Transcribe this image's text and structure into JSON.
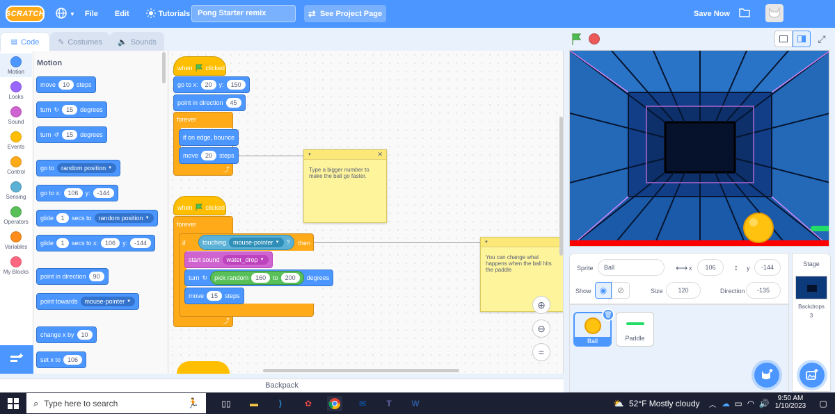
{
  "menubar": {
    "logo": "SCRATCH",
    "file": "File",
    "edit": "Edit",
    "tutorials": "Tutorials",
    "project_title": "Pong Starter remix",
    "see_project": "See Project Page",
    "save_now": "Save Now"
  },
  "tabs": {
    "code": "Code",
    "costumes": "Costumes",
    "sounds": "Sounds"
  },
  "categories": [
    {
      "label": "Motion",
      "color": "#4c97ff"
    },
    {
      "label": "Looks",
      "color": "#9966ff"
    },
    {
      "label": "Sound",
      "color": "#cf63cf"
    },
    {
      "label": "Events",
      "color": "#ffbf00"
    },
    {
      "label": "Control",
      "color": "#ffab19"
    },
    {
      "label": "Sensing",
      "color": "#5cb1d6"
    },
    {
      "label": "Operators",
      "color": "#59c059"
    },
    {
      "label": "Variables",
      "color": "#ff8c1a"
    },
    {
      "label": "My Blocks",
      "color": "#ff6680"
    }
  ],
  "palette": {
    "heading": "Motion",
    "move": {
      "a": "move",
      "v": "10",
      "b": "steps"
    },
    "turn_right": {
      "a": "turn",
      "v": "15",
      "b": "degrees"
    },
    "turn_left": {
      "a": "turn",
      "v": "15",
      "b": "degrees"
    },
    "goto": {
      "a": "go to",
      "dd": "random position"
    },
    "goto_xy": {
      "a": "go to x:",
      "x": "106",
      "b": "y:",
      "y": "-144"
    },
    "glide": {
      "a": "glide",
      "v": "1",
      "b": "secs to",
      "dd": "random position"
    },
    "glide_xy": {
      "a": "glide",
      "v": "1",
      "b": "secs to x:",
      "x": "106",
      "c": "y:",
      "y": "-144"
    },
    "point_dir": {
      "a": "point in direction",
      "v": "90"
    },
    "point_towards": {
      "a": "point towards",
      "dd": "mouse-pointer"
    },
    "change_x": {
      "a": "change x by",
      "v": "10"
    },
    "set_x": {
      "a": "set x to",
      "v": "106"
    }
  },
  "script1": {
    "when": "when",
    "clicked": "clicked",
    "goto_a": "go to x:",
    "goto_x": "20",
    "goto_b": "y:",
    "goto_y": "150",
    "point_a": "point in direction",
    "point_v": "45",
    "forever": "forever",
    "bounce": "if on edge, bounce",
    "move_a": "move",
    "move_v": "20",
    "move_b": "steps"
  },
  "script2": {
    "when": "when",
    "clicked": "clicked",
    "forever": "forever",
    "if": "if",
    "touching": "touching",
    "touching_dd": "mouse-pointer",
    "q": "?",
    "then": "then",
    "sound_a": "start sound",
    "sound_dd": "water_drop",
    "turn_a": "turn",
    "pick": "pick random",
    "pick_a": "160",
    "pick_to": "to",
    "pick_b": "200",
    "turn_b": "degrees",
    "move_a": "move",
    "move_v": "15",
    "move_b": "steps"
  },
  "notes": {
    "note1": "Type a bigger number to make the ball go faster.",
    "note2": "You can change what happens when the ball hits the paddle"
  },
  "backpack": "Backpack",
  "sprite_info": {
    "sprite_label": "Sprite",
    "sprite_name": "Ball",
    "x_label": "x",
    "x": "106",
    "y_label": "y",
    "y": "-144",
    "show_label": "Show",
    "size_label": "Size",
    "size": "120",
    "direction_label": "Direction",
    "direction": "-135"
  },
  "sprites": [
    {
      "name": "Ball"
    },
    {
      "name": "Paddle"
    }
  ],
  "stage_pane": {
    "title": "Stage",
    "backdrops_label": "Backdrops",
    "backdrops_count": "3"
  },
  "taskbar": {
    "search_placeholder": "Type here to search",
    "weather": "52°F  Mostly cloudy",
    "time": "9:50 AM",
    "date": "1/10/2023"
  }
}
